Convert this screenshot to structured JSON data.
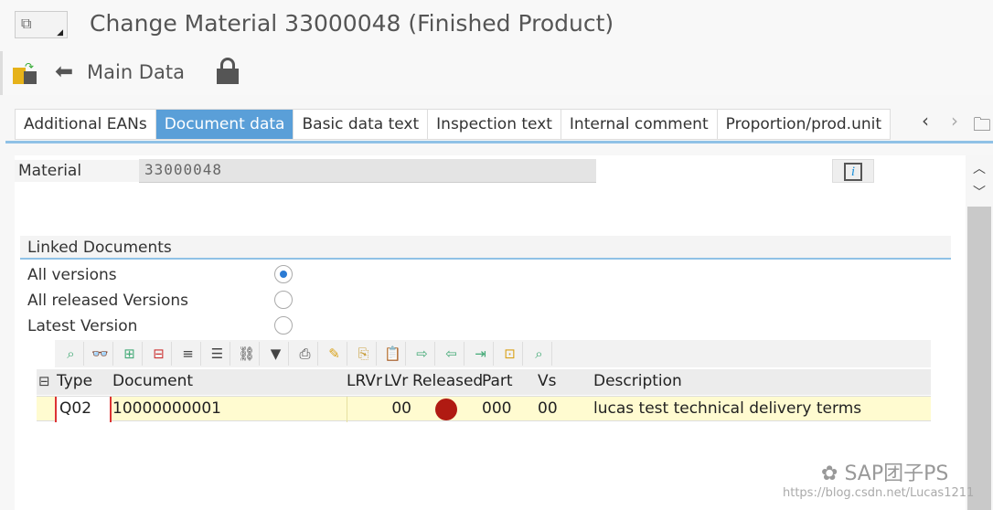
{
  "window": {
    "title": "Change Material 33000048 (Finished Product)"
  },
  "toolbar": {
    "main_data_label": "Main Data",
    "icons": [
      "switch-view-icon",
      "back-arrow-icon",
      "lock-icon"
    ]
  },
  "tabs": [
    {
      "label": "Additional EANs"
    },
    {
      "label": "Document data",
      "active": true
    },
    {
      "label": "Basic data text"
    },
    {
      "label": "Inspection text"
    },
    {
      "label": "Internal comment"
    },
    {
      "label": "Proportion/prod.unit"
    }
  ],
  "header": {
    "material_label": "Material",
    "material_value": "33000048",
    "info_button": "i"
  },
  "linked_documents": {
    "title": "Linked Documents",
    "options": [
      {
        "label": "All versions",
        "selected": true
      },
      {
        "label": "All released Versions",
        "selected": false
      },
      {
        "label": "Latest Version",
        "selected": false
      }
    ]
  },
  "grid": {
    "columns": [
      "Type",
      "Document",
      "LRVr",
      "LVr",
      "Released",
      "Part",
      "Vs",
      "Description"
    ],
    "rows": [
      {
        "type": "Q02",
        "document": "10000000001",
        "lrvr": "",
        "lvr": "00",
        "released_status_color": "#b01a12",
        "part": "000",
        "vs": "00",
        "description": "lucas test technical delivery terms"
      }
    ]
  },
  "watermark": {
    "brand": "SAP团子PS",
    "url": "https://blog.csdn.net/Lucas1211"
  },
  "colors": {
    "active_tab": "#5a9fd8",
    "row_highlight": "#fffbd0"
  }
}
